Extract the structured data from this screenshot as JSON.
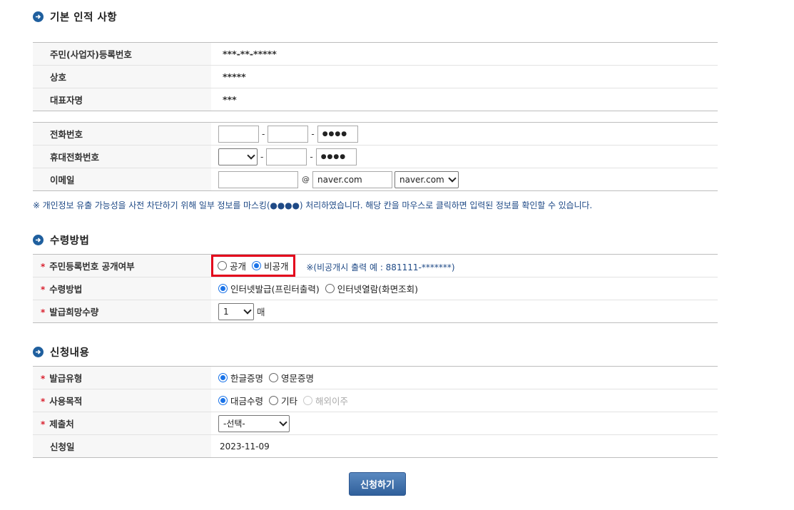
{
  "sections": {
    "basic": "기본 인적 사항",
    "receive": "수령방법",
    "apply": "신청내용"
  },
  "basic_info": {
    "rrn_label": "주민(사업자)등록번호",
    "rrn_value": "***-**-*****",
    "company_label": "상호",
    "company_value": "*****",
    "rep_label": "대표자명",
    "rep_value": "***"
  },
  "contact": {
    "phone_label": "전화번호",
    "phone_1": "",
    "phone_2": "",
    "phone_3": "●●●●",
    "mobile_label": "휴대전화번호",
    "mobile_1": "",
    "mobile_2": "",
    "mobile_3": "●●●●",
    "email_label": "이메일",
    "email_id": "",
    "email_at": "@",
    "email_domain": "naver.com",
    "email_domain_select": "naver.com",
    "dash": "-"
  },
  "notice": "※ 개인정보 유출 가능성을 사전 차단하기 위해 일부 정보를 마스킹(●●●●) 처리하였습니다. 해당 칸을 마우스로 클릭하면 입력된 정보를 확인할 수 있습니다.",
  "receive": {
    "disclose_label": "주민등록번호 공개여부",
    "disclose_options": [
      "공개",
      "비공개"
    ],
    "disclose_selected": "비공개",
    "disclose_hint": "※(비공개시 출력 예 : 881111-*******)",
    "method_label": "수령방법",
    "method_options": [
      "인터넷발급(프린터출력)",
      "인터넷열람(화면조회)"
    ],
    "method_selected": "인터넷발급(프린터출력)",
    "qty_label": "발급희망수량",
    "qty_value": "1",
    "qty_unit": "매"
  },
  "apply": {
    "type_label": "발급유형",
    "type_options": [
      "한글증명",
      "영문증명"
    ],
    "purpose_label": "사용목적",
    "purpose_options": [
      "대금수령",
      "기타",
      "해외이주"
    ],
    "submit_to_label": "제출처",
    "submit_to_value": "-선택-",
    "date_label": "신청일",
    "date_value": "2023-11-09"
  },
  "submit_label": "신청하기",
  "required_mark": "*",
  "colors": {
    "accent": "#1f5f9e",
    "required": "#d9202e",
    "highlight_box": "#e3001b",
    "radio": "#1a73e8",
    "notice": "#1f4a86"
  }
}
